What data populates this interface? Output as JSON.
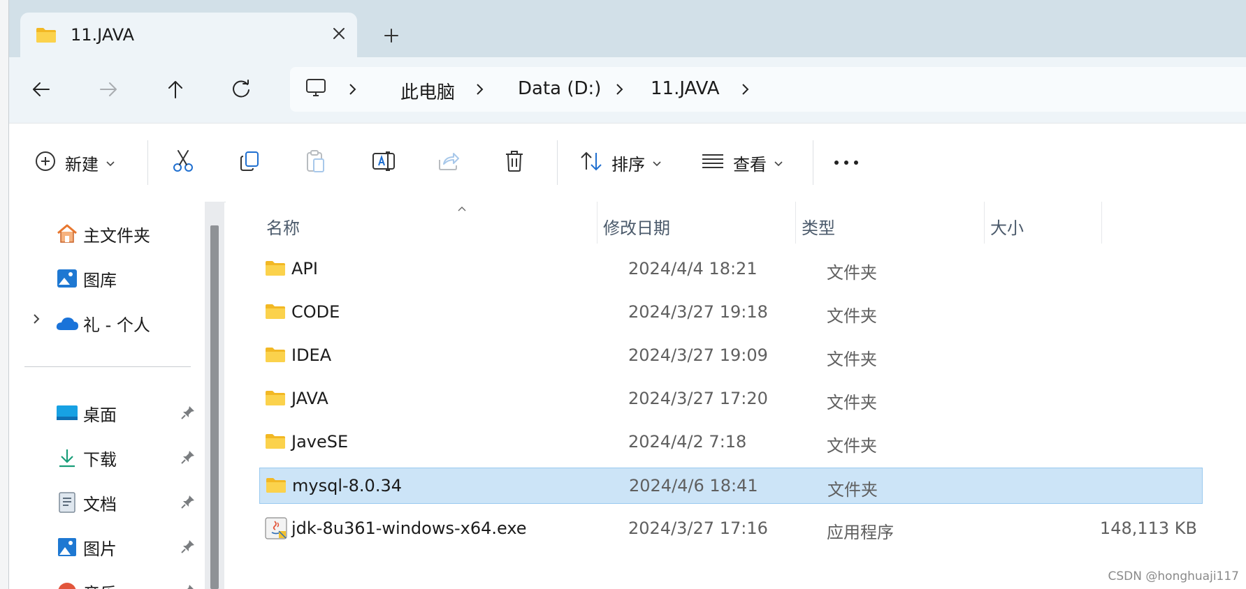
{
  "tab": {
    "title": "11.JAVA"
  },
  "address": {
    "crumbs": [
      "此电脑",
      "Data (D:)",
      "11.JAVA"
    ]
  },
  "toolbar": {
    "new_label": "新建",
    "sort_label": "排序",
    "view_label": "查看"
  },
  "nav": {
    "items": [
      {
        "label": "主文件夹",
        "icon": "home-icon"
      },
      {
        "label": "图库",
        "icon": "gallery-icon"
      },
      {
        "label": "礼 - 个人",
        "icon": "onedrive-icon"
      },
      {
        "label": "桌面",
        "icon": "desktop-icon"
      },
      {
        "label": "下载",
        "icon": "download-icon"
      },
      {
        "label": "文档",
        "icon": "document-icon"
      },
      {
        "label": "图片",
        "icon": "pictures-icon"
      },
      {
        "label": "音乐",
        "icon": "music-icon"
      }
    ]
  },
  "columns": {
    "name": "名称",
    "date": "修改日期",
    "type": "类型",
    "size": "大小"
  },
  "files": [
    {
      "name": "API",
      "date": "2024/4/4 18:21",
      "type": "文件夹",
      "size": "",
      "icon": "folder-icon"
    },
    {
      "name": "CODE",
      "date": "2024/3/27 19:18",
      "type": "文件夹",
      "size": "",
      "icon": "folder-icon"
    },
    {
      "name": "IDEA",
      "date": "2024/3/27 19:09",
      "type": "文件夹",
      "size": "",
      "icon": "folder-icon"
    },
    {
      "name": "JAVA",
      "date": "2024/3/27 17:20",
      "type": "文件夹",
      "size": "",
      "icon": "folder-icon"
    },
    {
      "name": "JaveSE",
      "date": "2024/4/2 7:18",
      "type": "文件夹",
      "size": "",
      "icon": "folder-icon"
    },
    {
      "name": "mysql-8.0.34",
      "date": "2024/4/6 18:41",
      "type": "文件夹",
      "size": "",
      "icon": "folder-icon",
      "selected": true
    },
    {
      "name": "jdk-8u361-windows-x64.exe",
      "date": "2024/3/27 17:16",
      "type": "应用程序",
      "size": "148,113 KB",
      "icon": "java-installer-icon"
    }
  ],
  "watermark": "CSDN @honghuaji117",
  "colors": {
    "accent": "#005fb8",
    "selection_bg": "#cce4f7",
    "folder_yellow": "#f8c53a"
  }
}
